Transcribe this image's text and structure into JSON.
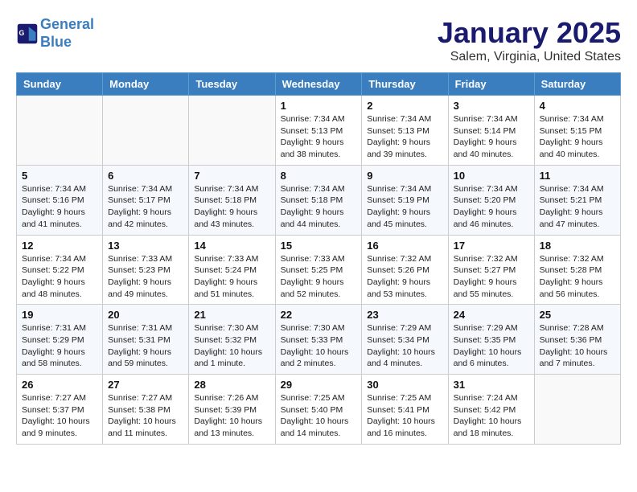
{
  "header": {
    "logo_line1": "General",
    "logo_line2": "Blue",
    "title": "January 2025",
    "subtitle": "Salem, Virginia, United States"
  },
  "weekdays": [
    "Sunday",
    "Monday",
    "Tuesday",
    "Wednesday",
    "Thursday",
    "Friday",
    "Saturday"
  ],
  "weeks": [
    [
      {
        "day": "",
        "info": ""
      },
      {
        "day": "",
        "info": ""
      },
      {
        "day": "",
        "info": ""
      },
      {
        "day": "1",
        "info": "Sunrise: 7:34 AM\nSunset: 5:13 PM\nDaylight: 9 hours\nand 38 minutes."
      },
      {
        "day": "2",
        "info": "Sunrise: 7:34 AM\nSunset: 5:13 PM\nDaylight: 9 hours\nand 39 minutes."
      },
      {
        "day": "3",
        "info": "Sunrise: 7:34 AM\nSunset: 5:14 PM\nDaylight: 9 hours\nand 40 minutes."
      },
      {
        "day": "4",
        "info": "Sunrise: 7:34 AM\nSunset: 5:15 PM\nDaylight: 9 hours\nand 40 minutes."
      }
    ],
    [
      {
        "day": "5",
        "info": "Sunrise: 7:34 AM\nSunset: 5:16 PM\nDaylight: 9 hours\nand 41 minutes."
      },
      {
        "day": "6",
        "info": "Sunrise: 7:34 AM\nSunset: 5:17 PM\nDaylight: 9 hours\nand 42 minutes."
      },
      {
        "day": "7",
        "info": "Sunrise: 7:34 AM\nSunset: 5:18 PM\nDaylight: 9 hours\nand 43 minutes."
      },
      {
        "day": "8",
        "info": "Sunrise: 7:34 AM\nSunset: 5:18 PM\nDaylight: 9 hours\nand 44 minutes."
      },
      {
        "day": "9",
        "info": "Sunrise: 7:34 AM\nSunset: 5:19 PM\nDaylight: 9 hours\nand 45 minutes."
      },
      {
        "day": "10",
        "info": "Sunrise: 7:34 AM\nSunset: 5:20 PM\nDaylight: 9 hours\nand 46 minutes."
      },
      {
        "day": "11",
        "info": "Sunrise: 7:34 AM\nSunset: 5:21 PM\nDaylight: 9 hours\nand 47 minutes."
      }
    ],
    [
      {
        "day": "12",
        "info": "Sunrise: 7:34 AM\nSunset: 5:22 PM\nDaylight: 9 hours\nand 48 minutes."
      },
      {
        "day": "13",
        "info": "Sunrise: 7:33 AM\nSunset: 5:23 PM\nDaylight: 9 hours\nand 49 minutes."
      },
      {
        "day": "14",
        "info": "Sunrise: 7:33 AM\nSunset: 5:24 PM\nDaylight: 9 hours\nand 51 minutes."
      },
      {
        "day": "15",
        "info": "Sunrise: 7:33 AM\nSunset: 5:25 PM\nDaylight: 9 hours\nand 52 minutes."
      },
      {
        "day": "16",
        "info": "Sunrise: 7:32 AM\nSunset: 5:26 PM\nDaylight: 9 hours\nand 53 minutes."
      },
      {
        "day": "17",
        "info": "Sunrise: 7:32 AM\nSunset: 5:27 PM\nDaylight: 9 hours\nand 55 minutes."
      },
      {
        "day": "18",
        "info": "Sunrise: 7:32 AM\nSunset: 5:28 PM\nDaylight: 9 hours\nand 56 minutes."
      }
    ],
    [
      {
        "day": "19",
        "info": "Sunrise: 7:31 AM\nSunset: 5:29 PM\nDaylight: 9 hours\nand 58 minutes."
      },
      {
        "day": "20",
        "info": "Sunrise: 7:31 AM\nSunset: 5:31 PM\nDaylight: 9 hours\nand 59 minutes."
      },
      {
        "day": "21",
        "info": "Sunrise: 7:30 AM\nSunset: 5:32 PM\nDaylight: 10 hours\nand 1 minute."
      },
      {
        "day": "22",
        "info": "Sunrise: 7:30 AM\nSunset: 5:33 PM\nDaylight: 10 hours\nand 2 minutes."
      },
      {
        "day": "23",
        "info": "Sunrise: 7:29 AM\nSunset: 5:34 PM\nDaylight: 10 hours\nand 4 minutes."
      },
      {
        "day": "24",
        "info": "Sunrise: 7:29 AM\nSunset: 5:35 PM\nDaylight: 10 hours\nand 6 minutes."
      },
      {
        "day": "25",
        "info": "Sunrise: 7:28 AM\nSunset: 5:36 PM\nDaylight: 10 hours\nand 7 minutes."
      }
    ],
    [
      {
        "day": "26",
        "info": "Sunrise: 7:27 AM\nSunset: 5:37 PM\nDaylight: 10 hours\nand 9 minutes."
      },
      {
        "day": "27",
        "info": "Sunrise: 7:27 AM\nSunset: 5:38 PM\nDaylight: 10 hours\nand 11 minutes."
      },
      {
        "day": "28",
        "info": "Sunrise: 7:26 AM\nSunset: 5:39 PM\nDaylight: 10 hours\nand 13 minutes."
      },
      {
        "day": "29",
        "info": "Sunrise: 7:25 AM\nSunset: 5:40 PM\nDaylight: 10 hours\nand 14 minutes."
      },
      {
        "day": "30",
        "info": "Sunrise: 7:25 AM\nSunset: 5:41 PM\nDaylight: 10 hours\nand 16 minutes."
      },
      {
        "day": "31",
        "info": "Sunrise: 7:24 AM\nSunset: 5:42 PM\nDaylight: 10 hours\nand 18 minutes."
      },
      {
        "day": "",
        "info": ""
      }
    ]
  ]
}
